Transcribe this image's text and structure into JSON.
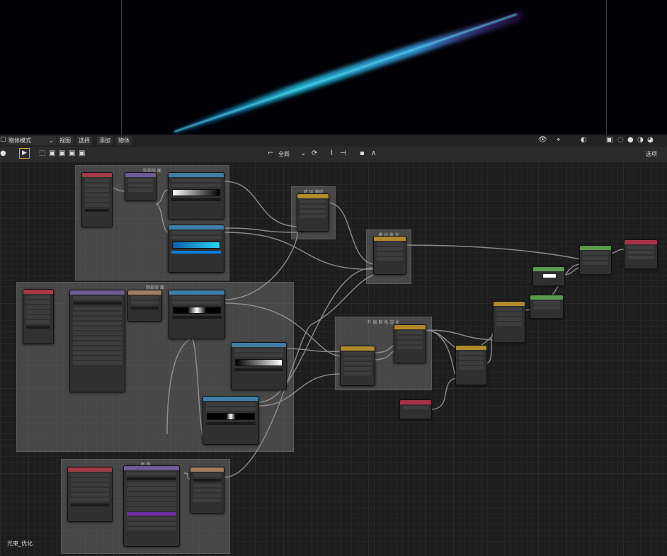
{
  "header": {
    "mode": "物体模式",
    "menu": [
      "视图",
      "选择",
      "添加",
      "物体"
    ]
  },
  "toolbar": {
    "global": "全局",
    "options": "选项"
  },
  "frames": {
    "top": "粒部层 面",
    "middle": "颜部层 面",
    "bottom": "颜 面",
    "mix_top": "遮 层 通道",
    "mix_right": "模 块 叠 加",
    "mix_mid": "升 级 颜 色 渲 化"
  },
  "material_name": "光束_优化",
  "colors": {
    "viewport_bg": "#020206",
    "beam_start": "#0b57a8",
    "beam_mid": "#22c6e6",
    "beam_end": "#7a2ad0"
  }
}
